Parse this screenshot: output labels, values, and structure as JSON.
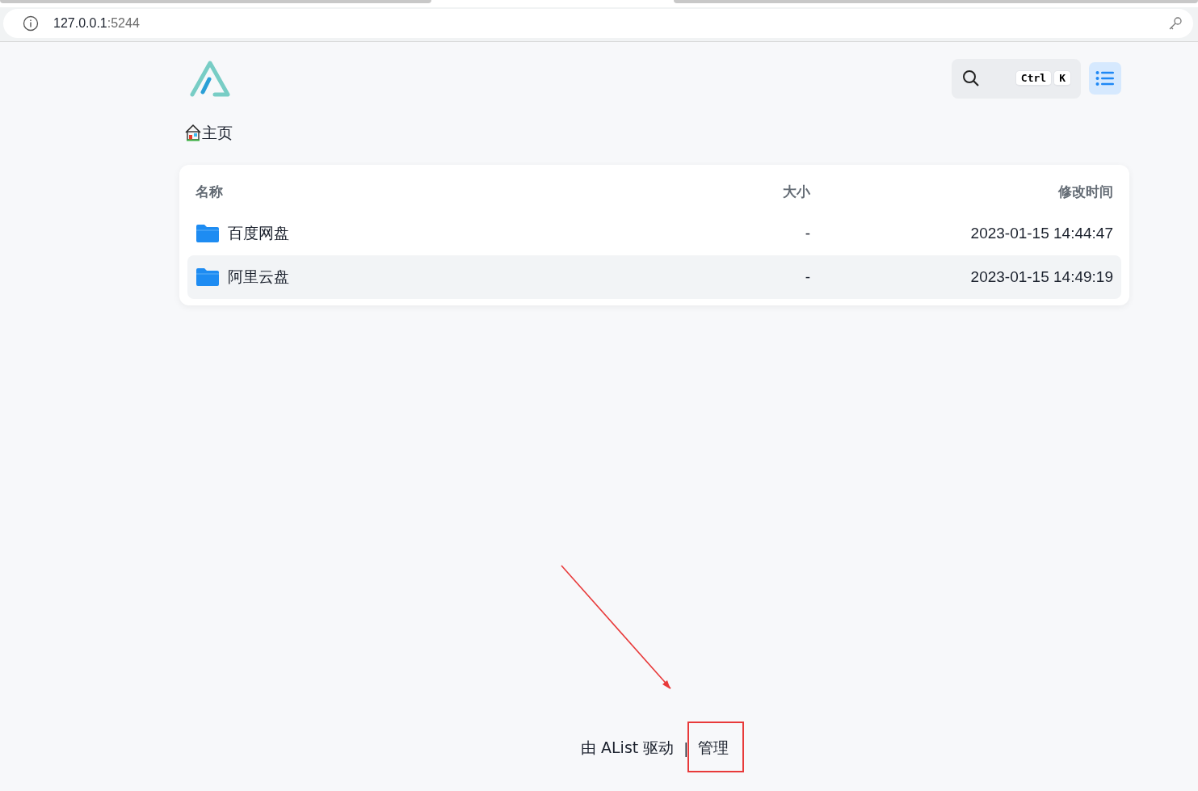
{
  "browser": {
    "address_host": "127.0.0.1",
    "address_port": ":5244"
  },
  "header": {
    "search_keys": [
      "Ctrl",
      "K"
    ]
  },
  "breadcrumb": {
    "label": "主页"
  },
  "table": {
    "columns": [
      "名称",
      "大小",
      "修改时间"
    ],
    "rows": [
      {
        "name": "百度网盘",
        "size": "-",
        "modified": "2023-01-15 14:44:47",
        "hovered": false
      },
      {
        "name": "阿里云盘",
        "size": "-",
        "modified": "2023-01-15 14:49:19",
        "hovered": true
      }
    ]
  },
  "footer": {
    "powered_by": "由 AList 驱动",
    "separator": "|",
    "manage": "管理"
  }
}
